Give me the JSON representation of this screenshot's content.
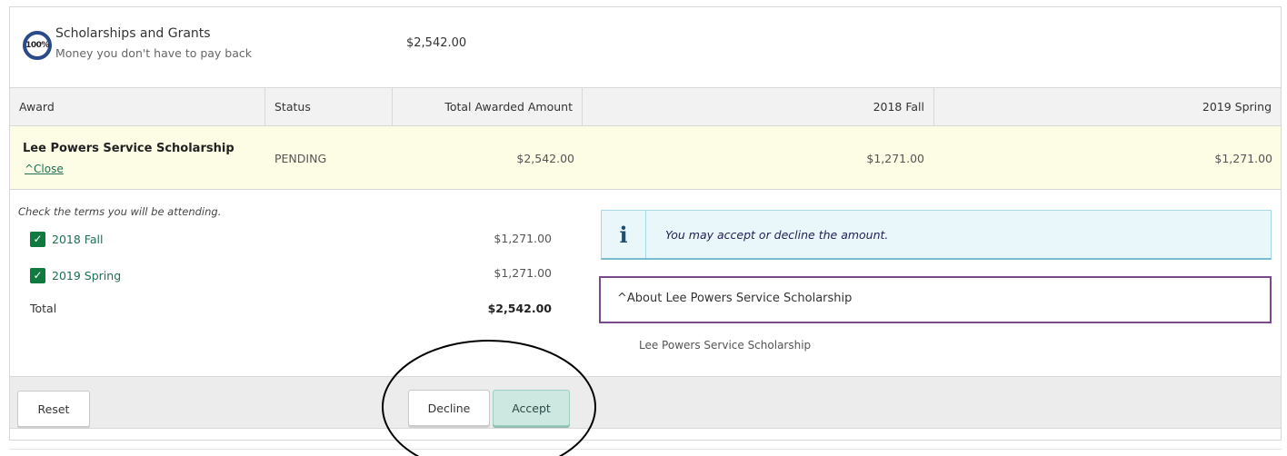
{
  "header": {
    "progress_label": "100%",
    "title": "Scholarships and Grants",
    "subtitle": "Money you don't have to pay back",
    "amount": "$2,542.00"
  },
  "table": {
    "columns": [
      "Award",
      "Status",
      "Total Awarded Amount",
      "2018 Fall",
      "2019 Spring"
    ],
    "row": {
      "award": "Lee Powers Service Scholarship",
      "toggle_label": "^Close",
      "status": "PENDING",
      "total": "$2,542.00",
      "fall": "$1,271.00",
      "spring": "$1,271.00"
    }
  },
  "terms": {
    "hint": "Check the terms you will be attending.",
    "items": [
      {
        "label": "2018 Fall",
        "amount": "$1,271.00",
        "checked": true
      },
      {
        "label": "2019 Spring",
        "amount": "$1,271.00",
        "checked": true
      }
    ],
    "total_label": "Total",
    "total_amount": "$2,542.00"
  },
  "info": {
    "icon": "info-icon",
    "message": "You may accept or decline the amount."
  },
  "about": {
    "toggle_label": "^About Lee Powers Service Scholarship",
    "description": "Lee Powers Service Scholarship"
  },
  "footer": {
    "reset_label": "Reset",
    "decline_label": "Decline",
    "accept_label": "Accept"
  },
  "colors": {
    "accent_green": "#0f7a3e",
    "link_green": "#1f6f53",
    "row_highlight": "#fdfce5",
    "info_bg": "#e9f7fb",
    "about_border": "#7a4a8a",
    "accept_bg": "#cce8e0"
  }
}
